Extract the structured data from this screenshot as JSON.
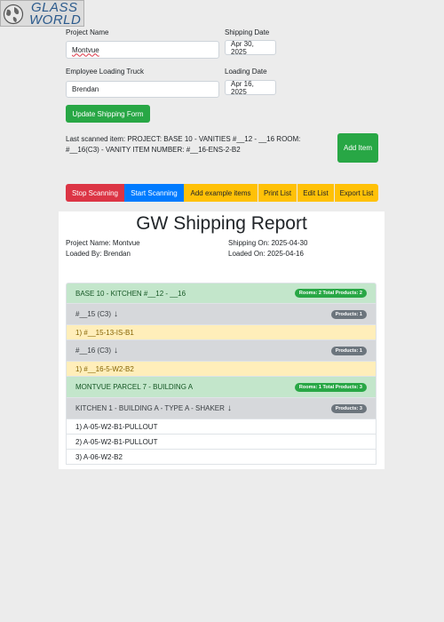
{
  "logo": {
    "line1": "GLASS",
    "line2": "WORLD"
  },
  "form": {
    "project_name_label": "Project Name",
    "project_name_value": "Montvue",
    "shipping_date_label": "Shipping Date",
    "shipping_date_value": "Apr 30, 2025",
    "employee_label": "Employee Loading Truck",
    "employee_value": "Brendan",
    "loading_date_label": "Loading Date",
    "loading_date_value": "Apr 16, 2025",
    "update_button": "Update Shipping Form"
  },
  "last_scanned": "Last scanned item: PROJECT: BASE 10 - VANITIES #__12 - __16 ROOM: #__16(C3) - VANITY ITEM NUMBER: #__16-ENS-2-B2",
  "add_item_button": "Add Item",
  "toolbar": {
    "stop_scanning": "Stop Scanning",
    "start_scanning": "Start Scanning",
    "add_example_items": "Add example items",
    "print_list": "Print List",
    "edit_list": "Edit List",
    "export_list": "Export List"
  },
  "report": {
    "title": "GW Shipping Report",
    "project_name": "Project Name: Montvue",
    "loaded_by": "Loaded By: Brendan",
    "shipping_on": "Shipping On: 2025-04-30",
    "loaded_on": "Loaded On: 2025-04-16"
  },
  "list": {
    "project1": {
      "name": "BASE 10 - KITCHEN #__12 - __16",
      "badge": "Rooms: 2 Total Products: 2"
    },
    "room1": {
      "name": "#__15 (C3)",
      "arrow": "↓",
      "badge": "Products: 1"
    },
    "item1": "1) #__15-13-IS-B1",
    "room2": {
      "name": "#__16 (C3)",
      "arrow": "↓",
      "badge": "Products: 1"
    },
    "item2": "1) #__16-5-W2-B2",
    "project2": {
      "name": "MONTVUE PARCEL 7 - BUILDING A",
      "badge": "Rooms: 1 Total Products: 3"
    },
    "room3": {
      "name": "KITCHEN 1 - BUILDING A - TYPE A - SHAKER",
      "arrow": "↓",
      "badge": "Products: 3"
    },
    "item3": "1) A-05-W2-B1-PULLOUT",
    "item4": "2) A-05-W2-B1-PULLOUT",
    "item5": "3) A-06-W2-B2"
  },
  "colors": {
    "green": "#28a745",
    "red": "#dc3545",
    "blue": "#007bff",
    "yellow": "#ffc107"
  }
}
